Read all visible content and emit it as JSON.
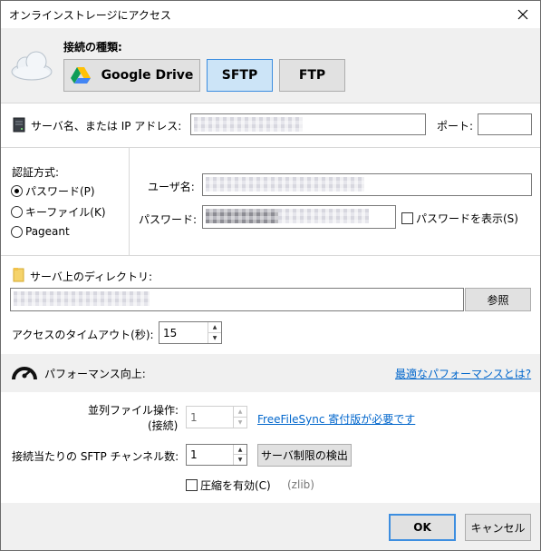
{
  "window": {
    "title": "オンラインストレージにアクセス"
  },
  "connection": {
    "type_label": "接続の種類:",
    "types": [
      "Google Drive",
      "SFTP",
      "FTP"
    ],
    "selected": "SFTP"
  },
  "server": {
    "label": "サーバ名、または IP アドレス:",
    "port_label": "ポート:",
    "port_value": ""
  },
  "auth": {
    "method_label": "認証方式:",
    "options": [
      "パスワード(P)",
      "キーファイル(K)",
      "Pageant"
    ],
    "selected": "パスワード(P)",
    "user_label": "ユーザ名:",
    "password_label": "パスワード:",
    "show_password_label": "パスワードを表示(S)"
  },
  "directory": {
    "label": "サーバ上のディレクトリ:",
    "browse_label": "参照"
  },
  "timeout": {
    "label": "アクセスのタイムアウト(秒):",
    "value": "15"
  },
  "performance": {
    "title": "パフォーマンス向上:",
    "help_link": "最適なパフォーマンスとは?",
    "parallel_label_line1": "並列ファイル操作:",
    "parallel_label_line2": "(接続)",
    "parallel_value": "1",
    "donation_link": "FreeFileSync 寄付版が必要です",
    "channels_label": "接続当たりの SFTP チャンネル数:",
    "channels_value": "1",
    "detect_label": "サーバ制限の検出",
    "compression_label": "圧縮を有効(C)",
    "compression_note": "(zlib)"
  },
  "footer": {
    "ok_label": "OK",
    "cancel_label": "キャンセル"
  },
  "colors": {
    "selected_button_bg": "#cce4f7",
    "selected_button_border": "#3d8ee0",
    "link": "#0066cc",
    "band_bg": "#f0f0f0"
  },
  "icons": {
    "close": "close-icon",
    "cloud": "cloud-icon",
    "google_drive": "google-drive-icon",
    "server": "server-icon",
    "folder": "folder-icon",
    "speedometer": "speedometer-icon"
  }
}
